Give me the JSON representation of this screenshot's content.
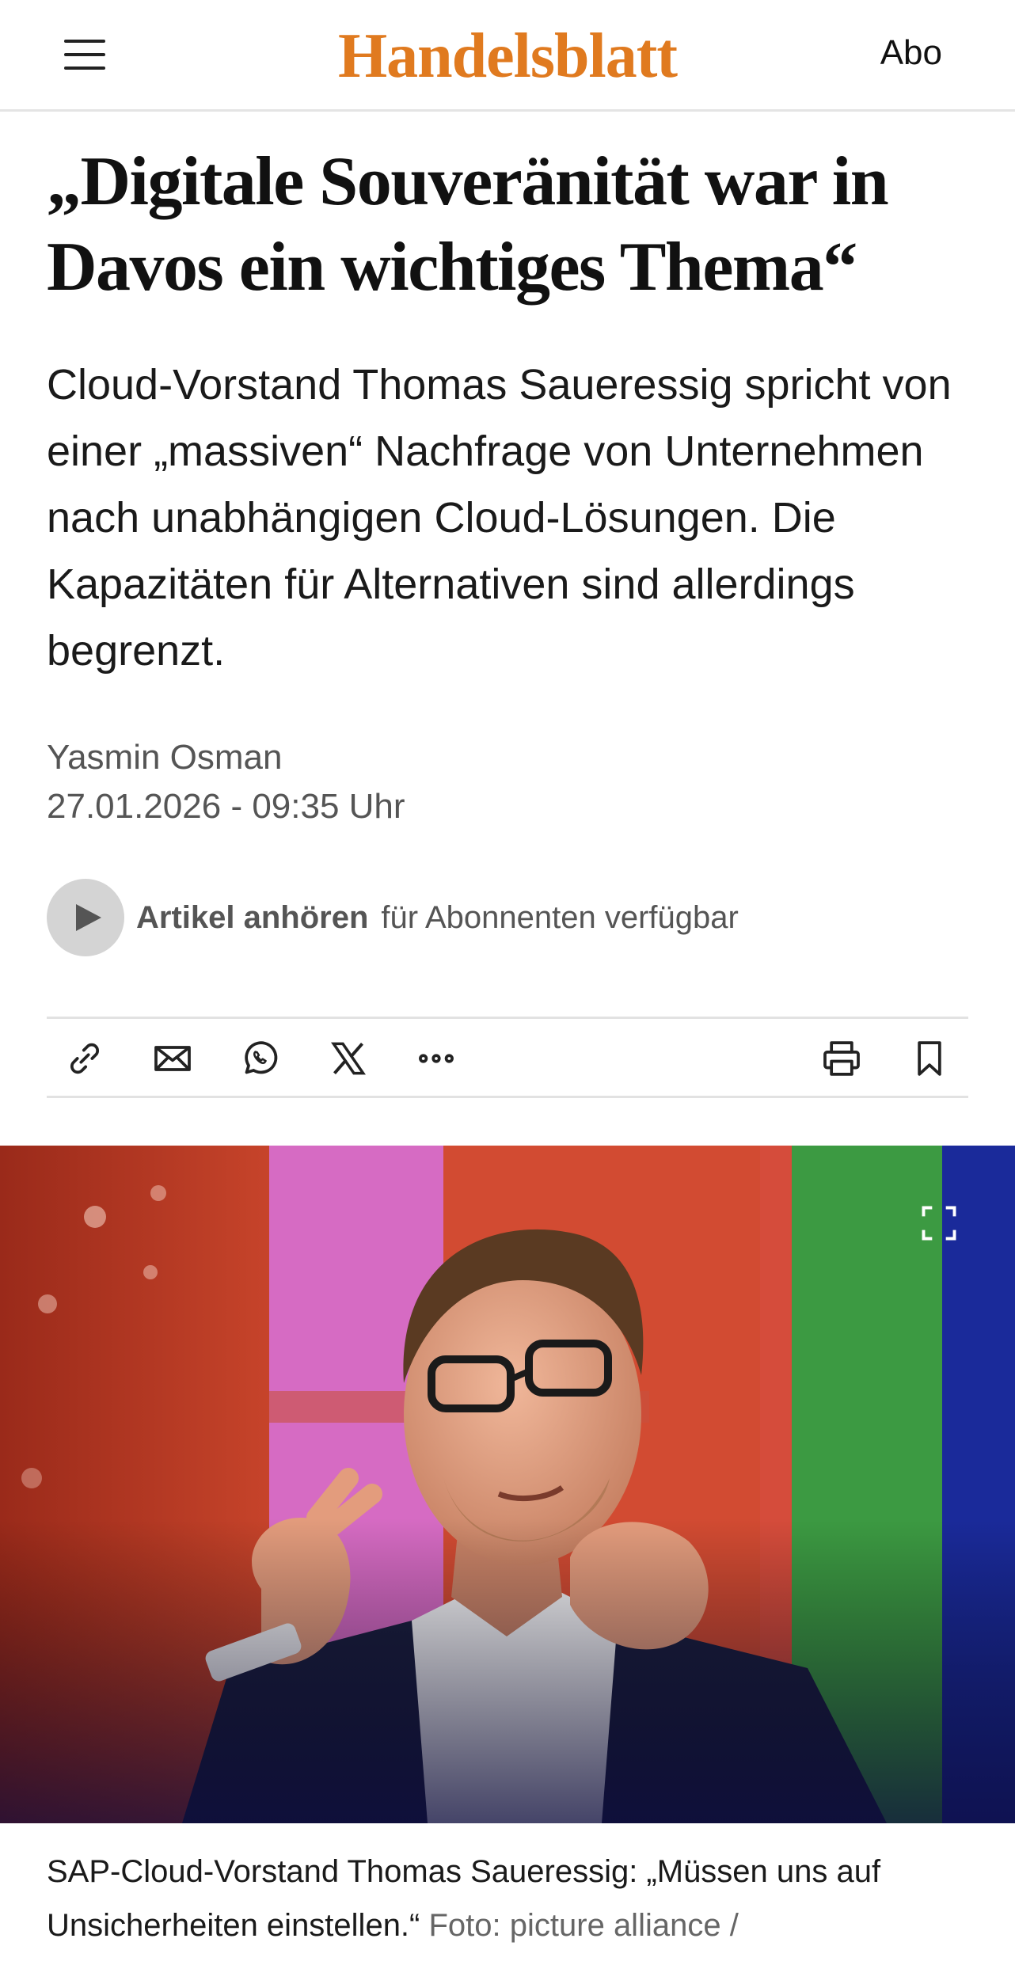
{
  "header": {
    "logo": "Handelsblatt",
    "subscribe_label": "Abo",
    "brand_color": "#e07a1f"
  },
  "article": {
    "headline": "„Digitale Souveränität war in Davos ein wichtiges Thema“",
    "lead": "Cloud-Vorstand Thomas Saueressig spricht von einer „massiven“ Nachfrage von Unternehmen nach unabhängigen Cloud-Lösungen. Die Kapazitäten für Alternativen sind allerdings begrenzt.",
    "author": "Yasmin Osman",
    "date": "27.01.2026 - 09:35 Uhr"
  },
  "audio": {
    "label": "Artikel anhören",
    "note": "für Abonnenten verfügbar"
  },
  "share_icons": [
    "link-icon",
    "mail-icon",
    "whatsapp-icon",
    "x-icon",
    "more-icon",
    "print-icon",
    "bookmark-icon"
  ],
  "image": {
    "caption": "SAP-Cloud-Vorstand Thomas Saueressig: „Müssen uns auf Unsicherheiten einstellen.“",
    "credit": "Foto: picture alliance /"
  }
}
